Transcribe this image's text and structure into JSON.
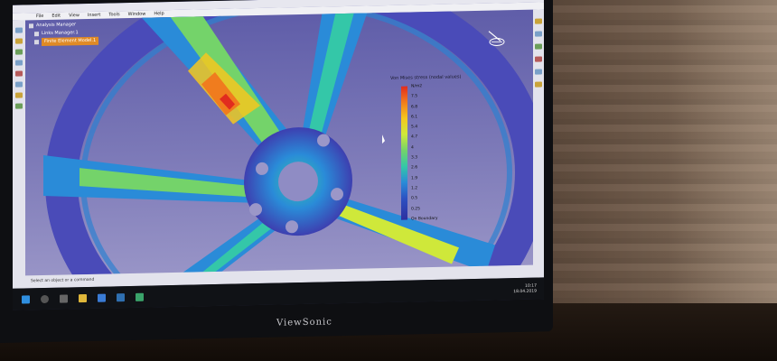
{
  "tree": {
    "root": "Analysis Manager",
    "child": "Links Manager.1",
    "selected": "Finite Element Model.1"
  },
  "menu": [
    "File",
    "Edit",
    "View",
    "Insert",
    "Tools",
    "Window",
    "Help"
  ],
  "legend": {
    "title": "Von Mises stress (nodal values)",
    "values": [
      "N/m2",
      "7.5",
      "6.8",
      "6.1",
      "5.4",
      "4.7",
      "4",
      "3.3",
      "2.6",
      "1.9",
      "1.2",
      "0.5",
      "0.25"
    ],
    "footer": "On Boundary"
  },
  "status": "Select an object or a command",
  "clock": {
    "time": "10:17",
    "date": "18.04.2019"
  },
  "brand": "ViewSonic",
  "colors": {
    "accent": "#e08a25",
    "fea_high": "#e12c1e",
    "fea_low": "#2e2f9f"
  },
  "icons": [
    "windows-start-icon",
    "search-icon",
    "task-view-icon",
    "explorer-icon",
    "browser-icon",
    "mail-icon",
    "catia-icon",
    "compass-icon"
  ]
}
